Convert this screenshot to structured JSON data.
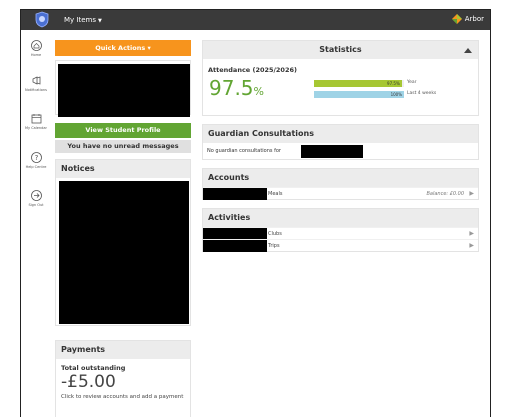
{
  "header": {
    "menu_label": "My Items",
    "brand_label": "Arbor"
  },
  "sidebar": {
    "items": [
      {
        "label": "Home",
        "icon": "home-icon"
      },
      {
        "label": "Notifications",
        "icon": "megaphone-icon"
      },
      {
        "label": "My Calendar",
        "icon": "calendar-icon"
      },
      {
        "label": "Help Centre",
        "icon": "question-icon"
      },
      {
        "label": "Sign Out",
        "icon": "sign-out-icon"
      }
    ]
  },
  "left": {
    "quick_actions_label": "Quick Actions",
    "view_profile_label": "View Student Profile",
    "messages_label": "You have no unread messages",
    "notices_title": "Notices",
    "payments_title": "Payments",
    "total_outstanding_label": "Total outstanding",
    "total_outstanding_amount": "-£5.00",
    "payments_link": "Click to review accounts and add a payment"
  },
  "statistics": {
    "title": "Statistics",
    "attendance_title": "Attendance (2025/2026)",
    "attendance_value": "97.5",
    "attendance_unit": "%",
    "bars": [
      {
        "value_label": "97.5%",
        "percent": 97.5,
        "label": "Year",
        "color": "#a6c733"
      },
      {
        "value_label": "100%",
        "percent": 100,
        "label": "Last 4 weeks",
        "color": "#9fd3e6"
      }
    ]
  },
  "guardian": {
    "title": "Guardian Consultations",
    "empty_text": "No guardian consultations for"
  },
  "accounts": {
    "title": "Accounts",
    "rows": [
      {
        "label": "Meals",
        "balance": "Balance: £0.00"
      }
    ]
  },
  "activities": {
    "title": "Activities",
    "rows": [
      {
        "label": "Clubs"
      },
      {
        "label": "Trips"
      }
    ]
  },
  "colors": {
    "topbar": "#3a3a3a",
    "orange": "#f7941d",
    "green": "#62a533",
    "panel_header": "#ececec"
  }
}
